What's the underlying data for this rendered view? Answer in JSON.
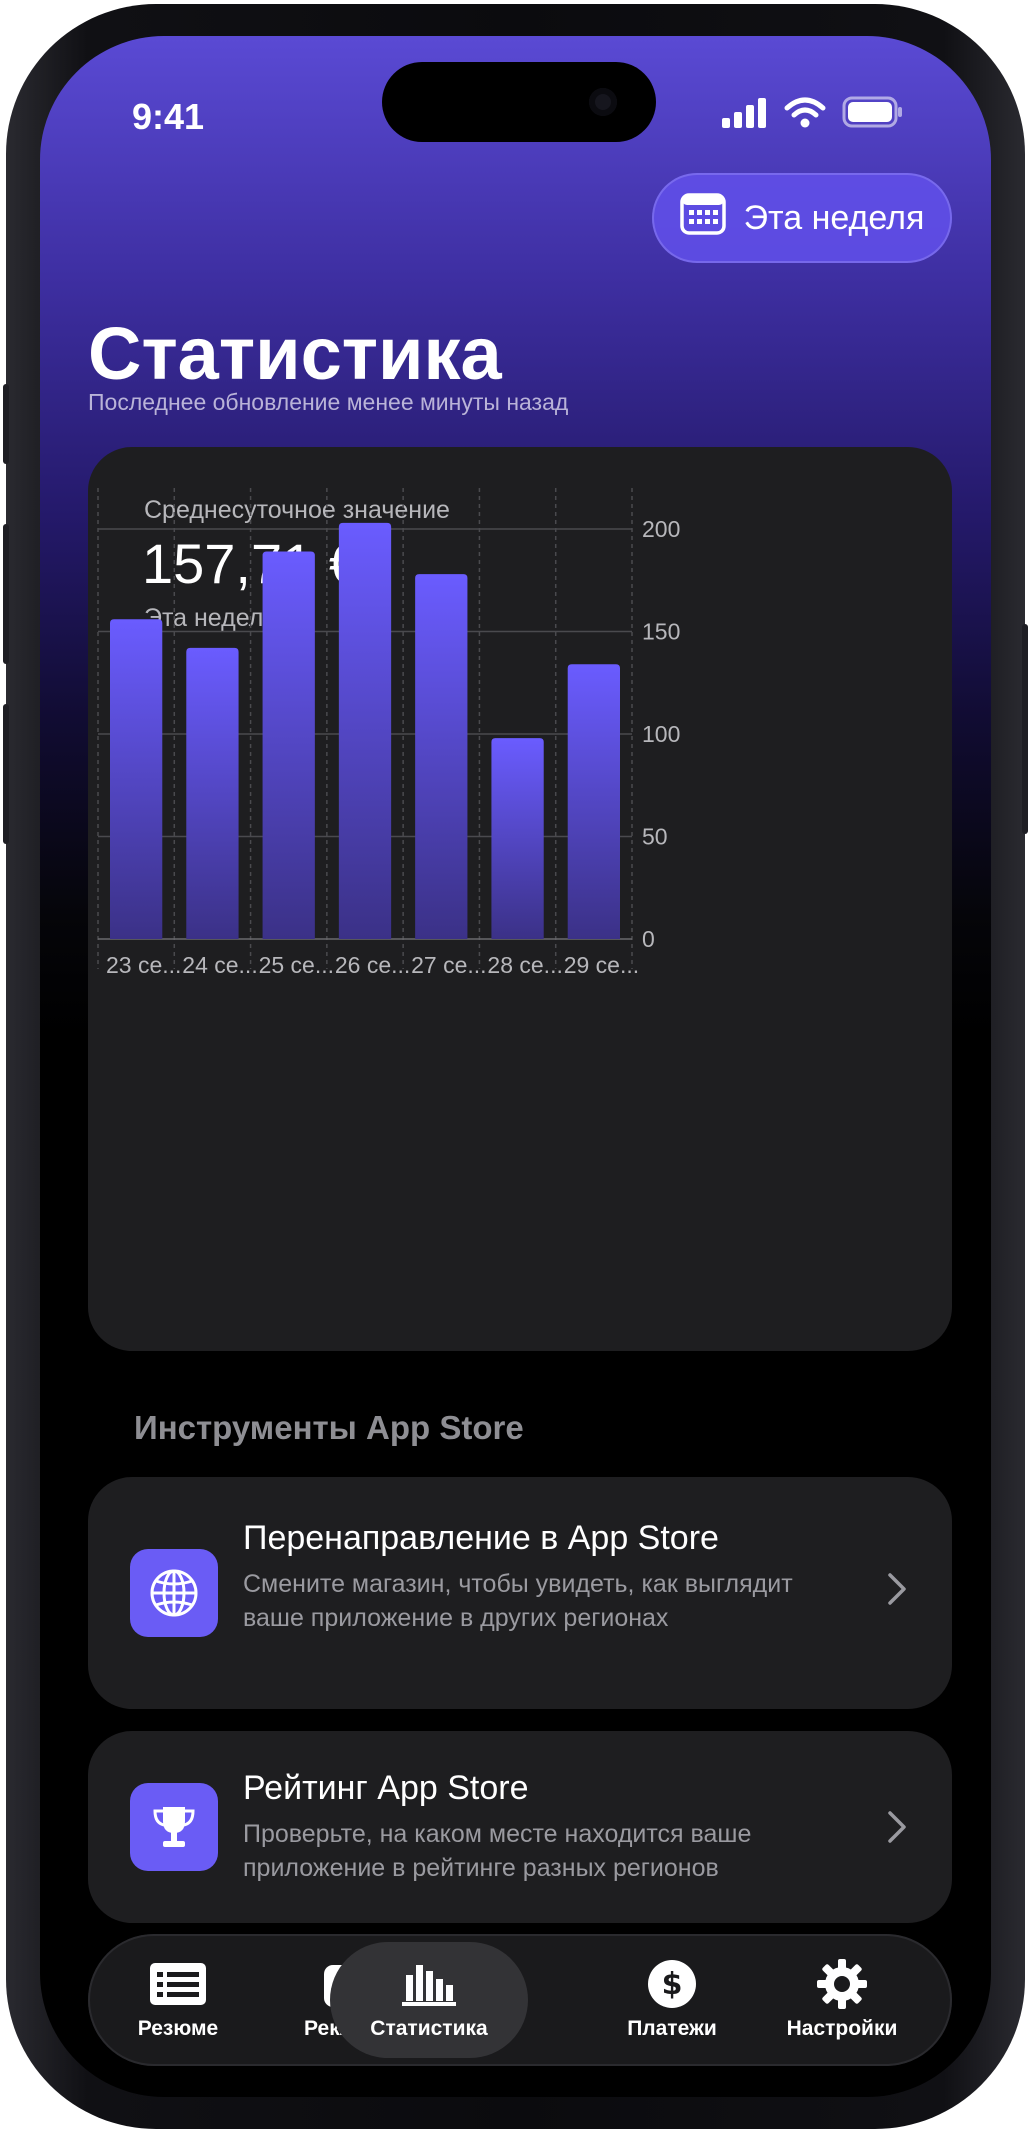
{
  "status_bar": {
    "time": "9:41"
  },
  "header": {
    "period_button": "Эта неделя",
    "title": "Статистика",
    "subtitle": "Последнее обновление менее минуты назад"
  },
  "stats_card": {
    "label": "Среднесуточное значение",
    "value": "157,71 €",
    "period": "Эта неделя"
  },
  "chart_data": {
    "type": "bar",
    "categories": [
      "23 се...",
      "24 се...",
      "25 се...",
      "26 се...",
      "27 се...",
      "28 се...",
      "29 се..."
    ],
    "values": [
      156,
      142,
      189,
      203,
      178,
      98,
      134
    ],
    "ylim": [
      0,
      220
    ],
    "yticks": [
      0,
      50,
      100,
      150,
      200
    ],
    "y_axis_position": "right",
    "grid": true,
    "bar_color_top": "#6a5cff",
    "bar_color_bottom": "#3b3187"
  },
  "tools": {
    "section_title": "Инструменты App Store",
    "items": [
      {
        "title": "Перенаправление в App Store",
        "description": "Смените магазин, чтобы увидеть, как выглядит ваше приложение в других регионах",
        "icon": "globe-icon"
      },
      {
        "title": "Рейтинг App Store",
        "description": "Проверьте, на каком месте находится ваше приложение в рейтинге разных регионов",
        "icon": "trophy-icon"
      }
    ]
  },
  "tabbar": {
    "items": [
      {
        "label": "Резюме",
        "icon": "list-icon"
      },
      {
        "label": "Реклама",
        "icon": "ad-badge-icon"
      },
      {
        "label": "Статистика",
        "icon": "bar-chart-icon",
        "active": true
      },
      {
        "label": "Платежи",
        "icon": "dollar-icon"
      },
      {
        "label": "Настройки",
        "icon": "gear-icon"
      }
    ]
  },
  "colors": {
    "accent": "#6a5cf5",
    "card": "#1e1e20",
    "header_gradient_top": "#5a4ad4"
  }
}
